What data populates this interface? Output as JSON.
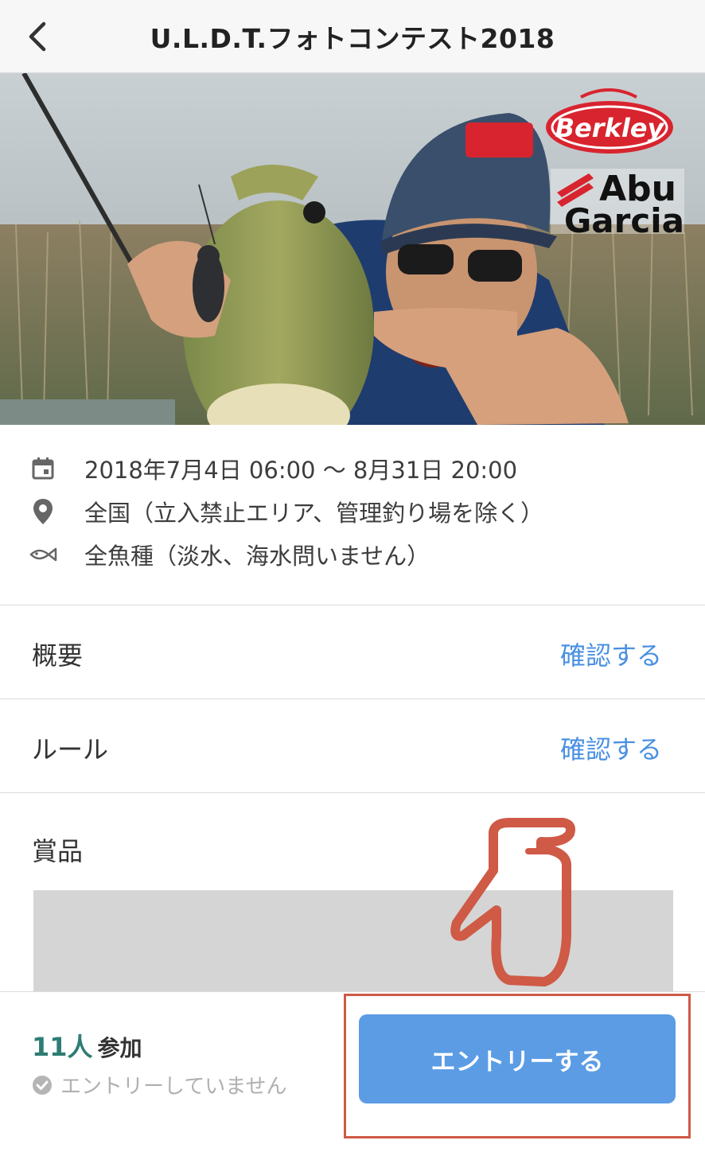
{
  "header": {
    "title": "U.L.D.T.フォトコンテスト2018",
    "back_icon": "chevron-left-icon"
  },
  "hero": {
    "logos": {
      "brand_1": "Berkley",
      "brand_2_line1": "Abu",
      "brand_2_line2": "Garcia",
      "colors": {
        "berkley_red": "#d8242f",
        "abu_black": "#111111",
        "abu_red": "#d8242f"
      }
    }
  },
  "info": {
    "date": {
      "icon": "calendar-icon",
      "text": "2018年7月4日 06:00 〜 8月31日 20:00"
    },
    "place": {
      "icon": "location-pin-icon",
      "text": "全国（立入禁止エリア、管理釣り場を除く）"
    },
    "species": {
      "icon": "fish-icon",
      "text": "全魚種（淡水、海水問いません）"
    }
  },
  "sections": {
    "overview": {
      "label": "概要",
      "link": "確認する"
    },
    "rules": {
      "label": "ルール",
      "link": "確認する"
    },
    "prizes": {
      "label": "賞品"
    }
  },
  "footer": {
    "participant_count": "11人",
    "participant_label": "参加",
    "status_icon": "check-circle-icon",
    "status_text": "エントリーしていません",
    "entry_button": "エントリーする"
  },
  "colors": {
    "link": "#4a90e2",
    "button": "#5b9ce5",
    "count": "#2e7d74",
    "annotation": "#cf5a46"
  }
}
